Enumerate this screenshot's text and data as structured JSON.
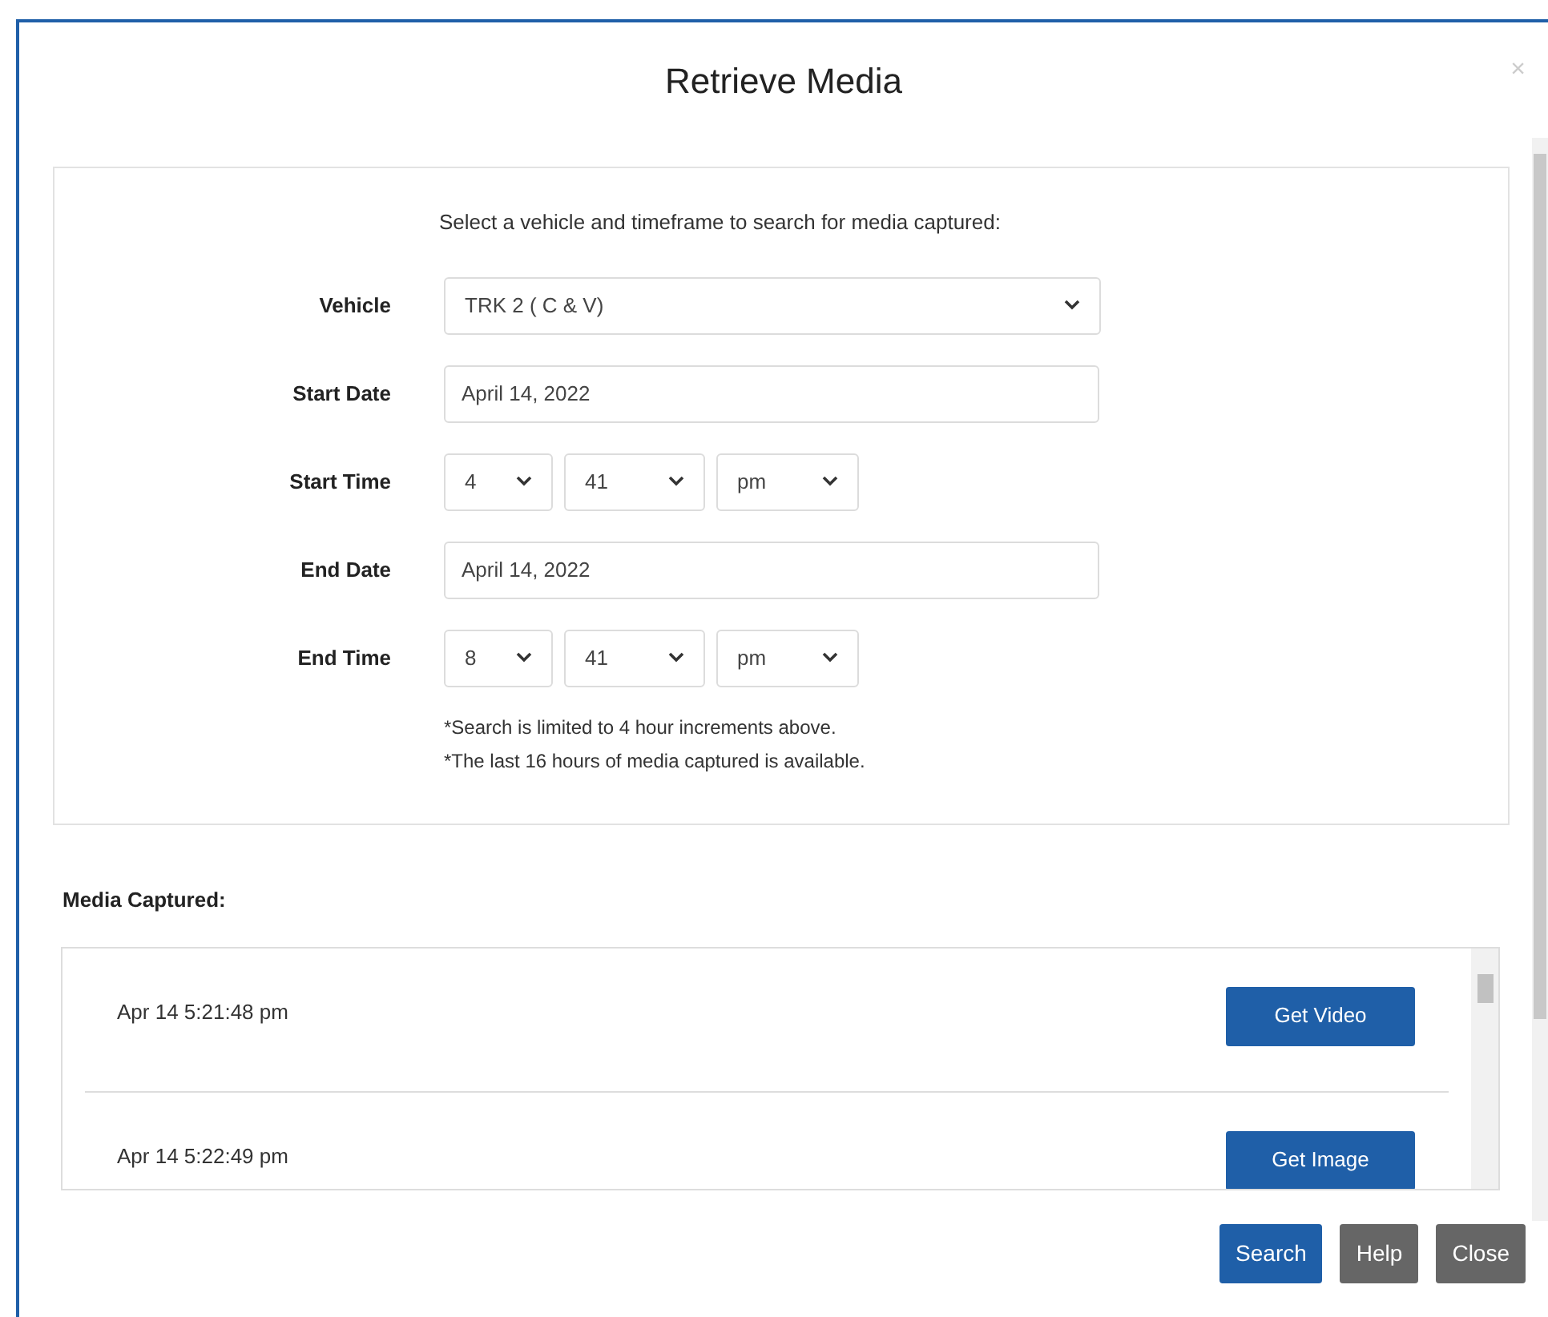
{
  "dialog": {
    "title": "Retrieve Media",
    "close_icon": "×"
  },
  "form": {
    "intro": "Select a vehicle and timeframe to search for media captured:",
    "fields": [
      {
        "kind": "select",
        "label": "Vehicle",
        "value": "TRK 2 ( C & V)"
      },
      {
        "kind": "date",
        "label": "Start Date",
        "value": "April 14, 2022"
      },
      {
        "kind": "time",
        "label": "Start Time",
        "parts": [
          "4",
          "41",
          "pm"
        ]
      },
      {
        "kind": "date",
        "label": "End Date",
        "value": "April 14, 2022"
      },
      {
        "kind": "time",
        "label": "End Time",
        "parts": [
          "8",
          "41",
          "pm"
        ]
      }
    ],
    "notes": [
      "*Search is limited to 4 hour increments above.",
      "*The last 16 hours of media captured is available."
    ]
  },
  "media": {
    "heading": "Media Captured:",
    "items": [
      {
        "time": "Apr 14 5:21:48 pm",
        "action": "Get Video"
      },
      {
        "time": "Apr 14 5:22:49 pm",
        "action": "Get Image"
      }
    ]
  },
  "buttons": [
    {
      "label": "Search",
      "kind": "primary"
    },
    {
      "label": "Help",
      "kind": "secondary"
    },
    {
      "label": "Close",
      "kind": "secondary"
    }
  ]
}
